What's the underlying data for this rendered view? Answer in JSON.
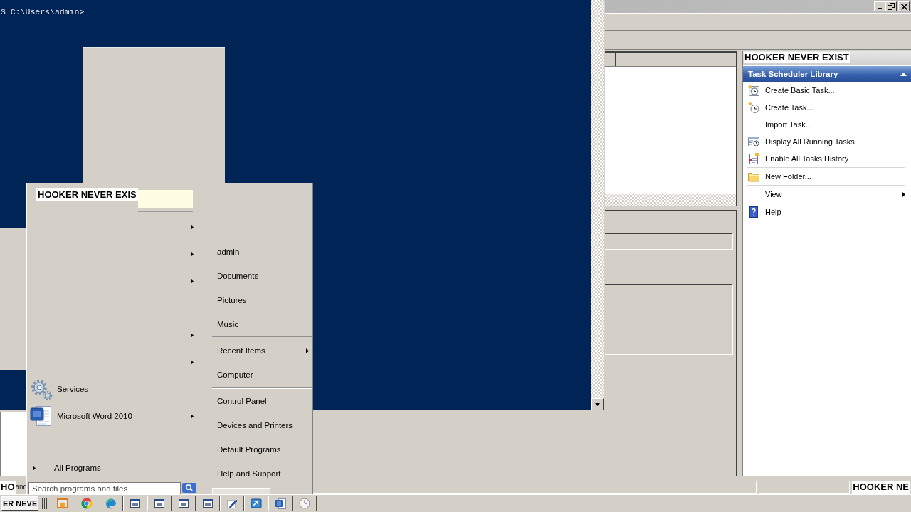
{
  "console": {
    "prompt": "S C:\\Users\\admin>"
  },
  "task_scheduler": {
    "actions_title": "HOOKER NEVER EXIST",
    "section": {
      "title": "Task Scheduler Library",
      "expanded": true
    },
    "action_groups": [
      [
        {
          "label": "Create Basic Task...",
          "submenu": false
        },
        {
          "label": "Create Task...",
          "submenu": false
        },
        {
          "label": "Import Task...",
          "submenu": false
        },
        {
          "label": "Display All Running Tasks",
          "submenu": false
        },
        {
          "label": "Enable All Tasks History",
          "submenu": false
        }
      ],
      [
        {
          "label": "New Folder...",
          "submenu": false
        }
      ],
      [
        {
          "label": "View",
          "submenu": true
        }
      ],
      [
        {
          "label": "Help",
          "submenu": false
        }
      ]
    ],
    "status_bar": [
      {
        "kind": "boxed",
        "text": "HO"
      },
      {
        "kind": "plain",
        "text": "anc"
      },
      {
        "kind": "panel"
      },
      {
        "kind": "panel"
      },
      {
        "kind": "boxed",
        "text": "HOOKER NE"
      }
    ]
  },
  "start_menu": {
    "user_name": "HOOKER NEVER EXIS",
    "programs": [
      {
        "submenu": true
      },
      {
        "submenu": true
      },
      {
        "submenu": true
      },
      {
        "submenu": false
      },
      {
        "submenu": true
      },
      {
        "submenu": true
      },
      {
        "label": "Services",
        "submenu": false
      },
      {
        "label": "Microsoft Word 2010",
        "submenu": true
      }
    ],
    "all_programs": "All Programs",
    "search": {
      "placeholder": "Search programs and files"
    },
    "place_groups": [
      [
        {
          "label": "admin",
          "submenu": false
        },
        {
          "label": "Documents",
          "submenu": false
        },
        {
          "label": "Pictures",
          "submenu": false
        },
        {
          "label": "Music",
          "submenu": false
        }
      ],
      [
        {
          "label": "Recent Items",
          "submenu": true
        },
        {
          "label": "Computer",
          "submenu": false
        }
      ],
      [
        {
          "label": "Control Panel",
          "submenu": false
        },
        {
          "label": "Devices and Printers",
          "submenu": false
        },
        {
          "label": "Default Programs",
          "submenu": false
        },
        {
          "label": "Help and Support",
          "submenu": false
        }
      ]
    ]
  },
  "taskbar": {
    "button": "ER NEVE"
  }
}
